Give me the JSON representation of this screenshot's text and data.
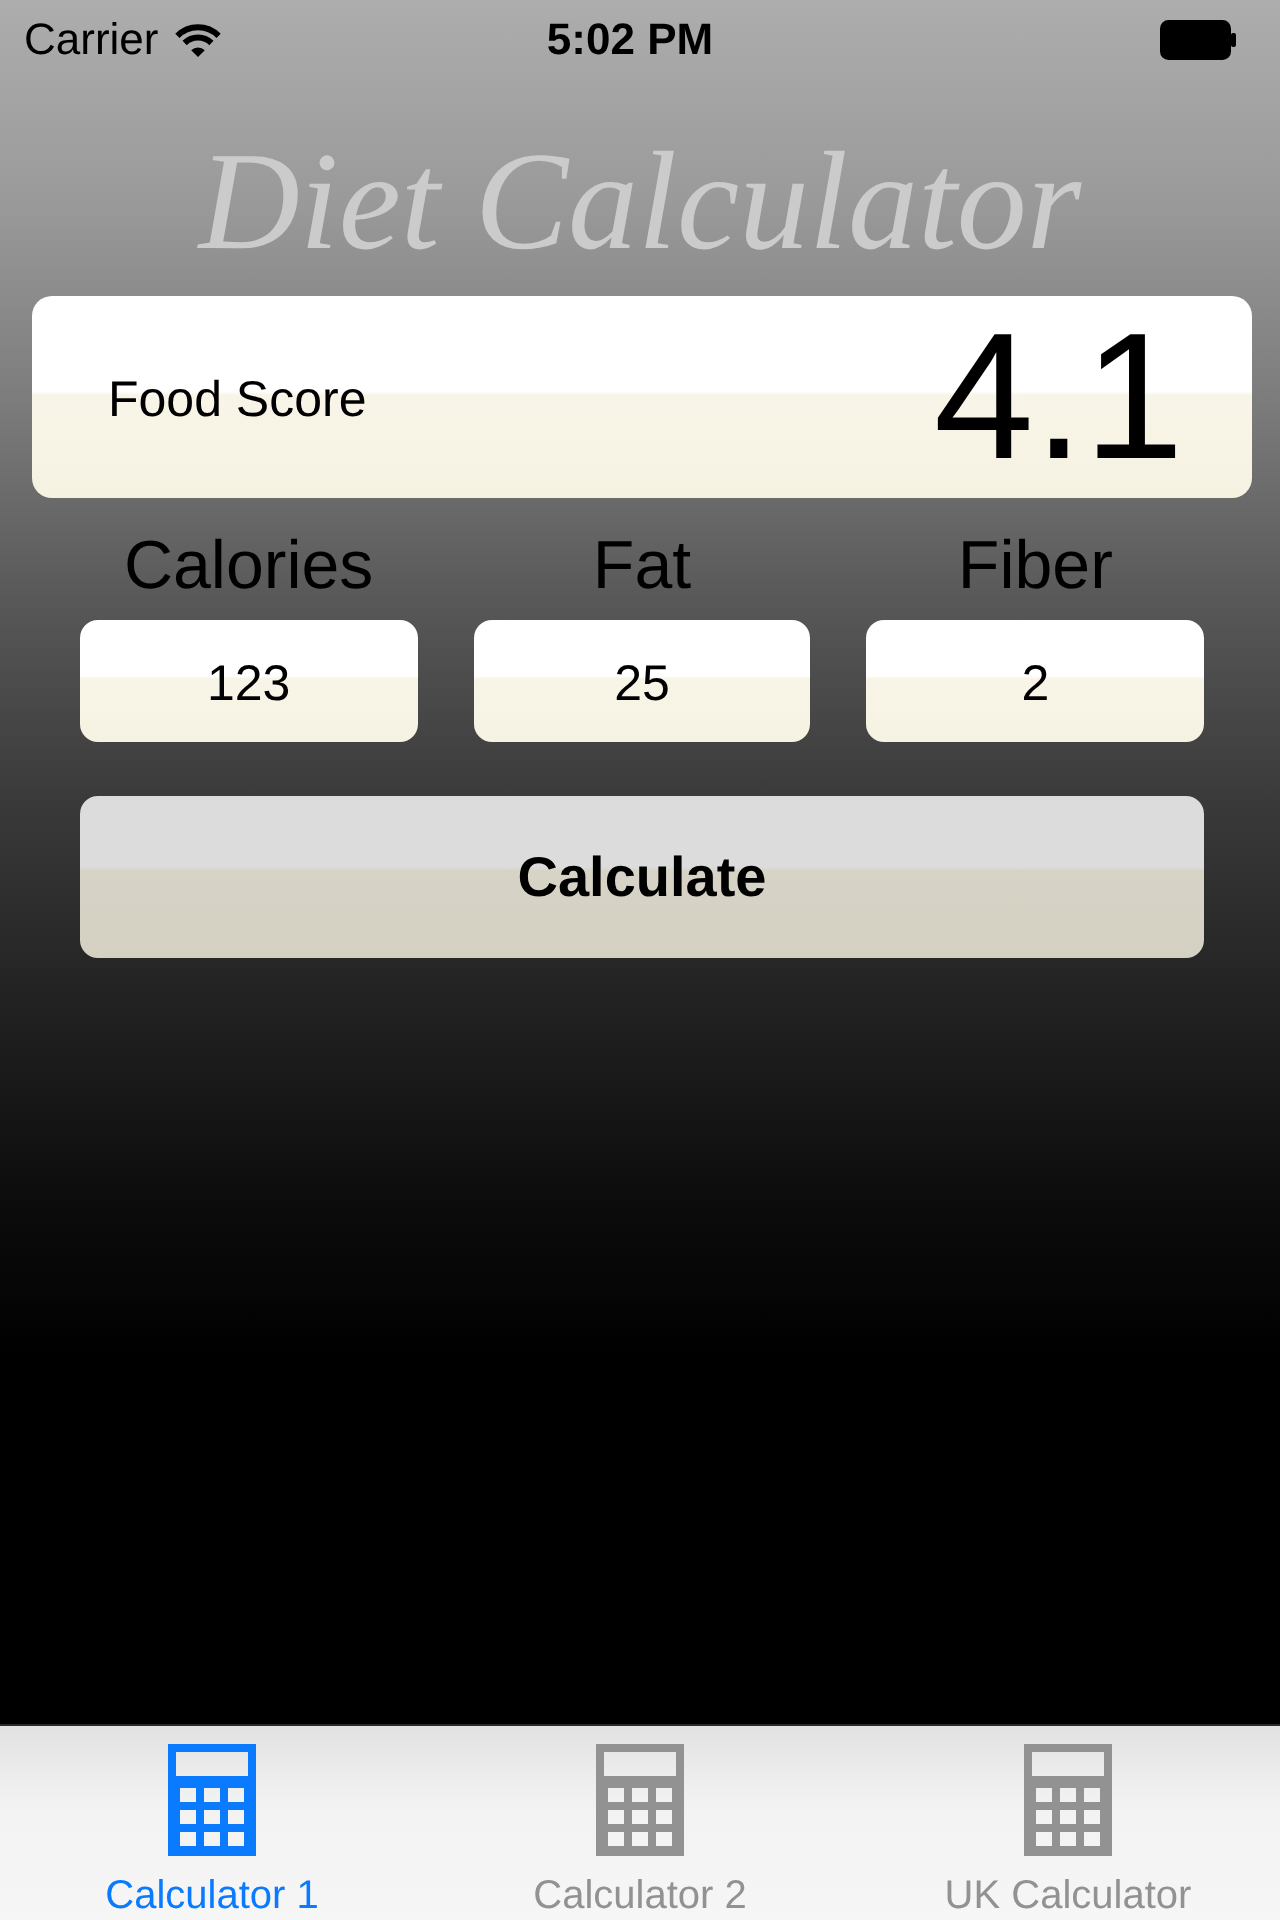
{
  "status_bar": {
    "carrier": "Carrier",
    "time": "5:02 PM"
  },
  "title": "Diet Calculator",
  "score": {
    "label": "Food Score",
    "value": "4.1"
  },
  "inputs": [
    {
      "label": "Calories",
      "value": "123"
    },
    {
      "label": "Fat",
      "value": "25"
    },
    {
      "label": "Fiber",
      "value": "2"
    }
  ],
  "button": "Calculate",
  "tabs": [
    {
      "label": "Calculator 1",
      "selected": true
    },
    {
      "label": "Calculator 2",
      "selected": false
    },
    {
      "label": "UK Calculator",
      "selected": false
    }
  ]
}
